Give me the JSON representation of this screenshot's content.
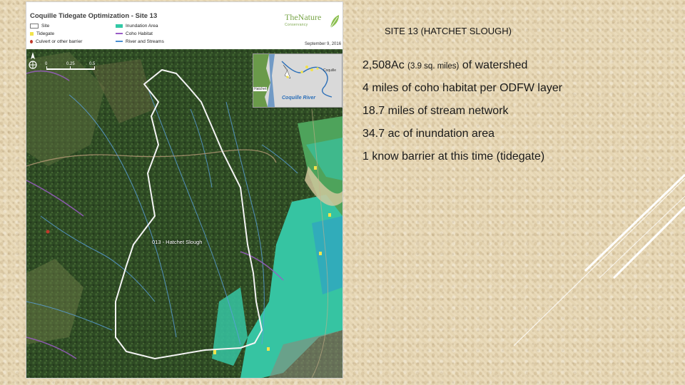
{
  "map": {
    "legend": {
      "title": "Coquille Tidegate Optimization - Site 13",
      "items": [
        {
          "label": "Site",
          "color": "#ffffff"
        },
        {
          "label": "Tidegate",
          "color": "#f2e34b"
        },
        {
          "label": "Culvert or other barrier",
          "color": "#c0392b"
        },
        {
          "label": "Inundation Area",
          "color": "#33c9a6"
        },
        {
          "label": "Coho Habitat",
          "color": "#9a5cc6"
        },
        {
          "label": "River and Streams",
          "color": "#4a8fd0"
        }
      ],
      "date": "September 9, 2016"
    },
    "logo": {
      "main": "TheNature",
      "sub": "Conservancy"
    },
    "scale": {
      "zero": "0",
      "mid": "0.25",
      "end": "0.5"
    },
    "inset": {
      "river_label": "Coquille River",
      "small_left": "Hatchet",
      "small_right": "Coquille"
    },
    "site_label": "013 - Hatchet Slough"
  },
  "slide": {
    "heading": "SITE 13 (HATCHET SLOUGH)",
    "bullets": [
      {
        "main": "2,508Ac ",
        "paren": "(3.9 sq. miles)",
        "rest": " of watershed"
      },
      {
        "main": "4 miles of coho habitat per ODFW layer"
      },
      {
        "main": "18.7 miles of stream network"
      },
      {
        "main": "34.7 ac of inundation area"
      },
      {
        "main": "1 know barrier at this time (tidegate)"
      }
    ]
  }
}
